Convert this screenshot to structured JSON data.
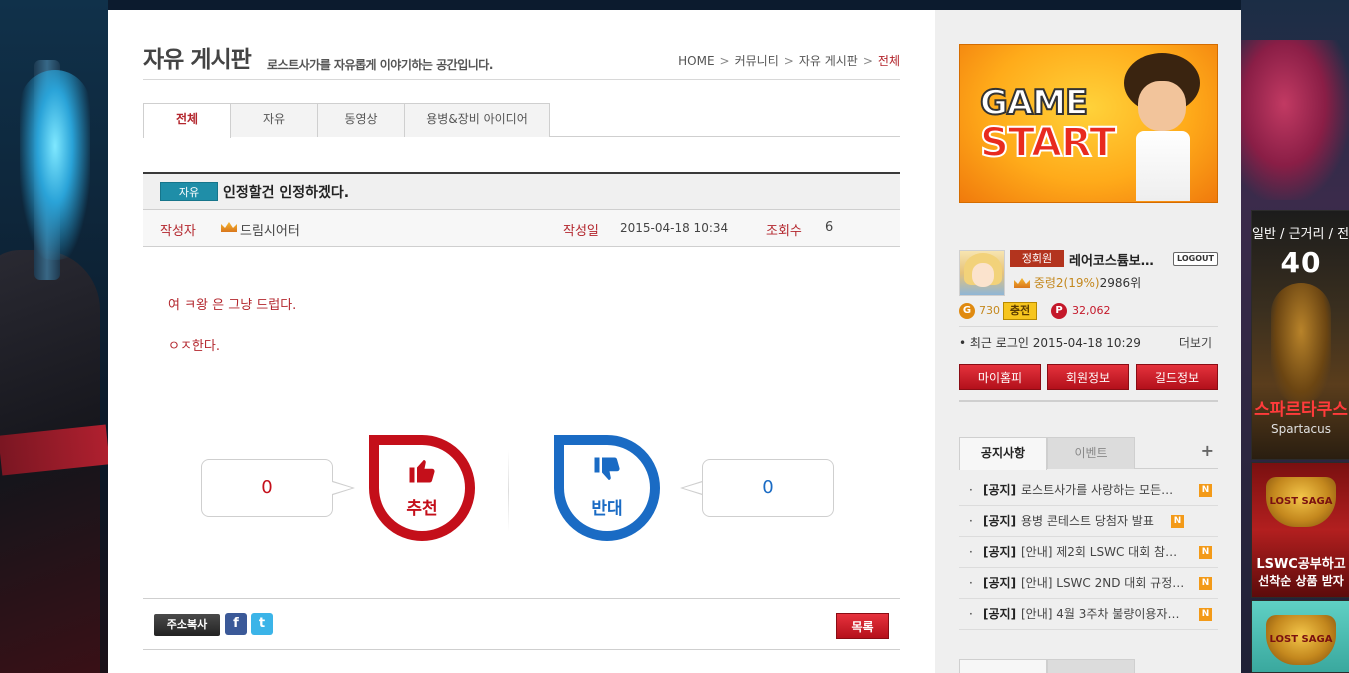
{
  "page": {
    "title": "자유 게시판",
    "subtitle": "로스트사가를 자유롭게 이야기하는 공간입니다."
  },
  "breadcrumb": [
    "HOME",
    "커뮤니티",
    "자유 게시판",
    "전체"
  ],
  "tabs": [
    {
      "label": "전체",
      "active": true
    },
    {
      "label": "자유",
      "active": false
    },
    {
      "label": "동영상",
      "active": false
    },
    {
      "label": "용병&장비 아이디어",
      "active": false
    }
  ],
  "post": {
    "category": "자유",
    "title": "인정할건 인정하겠다.",
    "author_label": "작성자",
    "author": "드림시어터",
    "date_label": "작성일",
    "date": "2015-04-18 10:34",
    "views_label": "조회수",
    "views": "6",
    "body": [
      "여 ㅋ왕 은 그냥 드럽다.",
      "ㅇㅈ한다."
    ]
  },
  "vote": {
    "up_count": "0",
    "up_label": "추천",
    "down_count": "0",
    "down_label": "반대",
    "up_icon": "thumbs-up-icon",
    "down_icon": "thumbs-down-icon"
  },
  "actions": {
    "copy_url": "주소복사",
    "facebook": "f",
    "twitter": "t",
    "list": "목록"
  },
  "sidebar": {
    "game_start": {
      "line1": "GAME",
      "line2": "START"
    },
    "profile": {
      "grade": "정회원",
      "name": "레어코스튬보…",
      "logout": "LOGOUT",
      "rank": "중령2(19%)",
      "rank_pos": "2986위",
      "gold_icon": "G",
      "gold": "730",
      "charge": "충전",
      "point_icon": "P",
      "points": "32,062",
      "last_login": "• 최근 로그인 2015-04-18 10:29",
      "more": "더보기"
    },
    "buttons": [
      "마이홈피",
      "회원정보",
      "길드정보"
    ],
    "notice_tabs": [
      "공지사항",
      "이벤트"
    ],
    "notices": [
      {
        "tag": "[공지]",
        "title": "로스트사가를 사랑하는 모든…"
      },
      {
        "tag": "[공지]",
        "title": "용병 콘테스트 당첨자 발표"
      },
      {
        "tag": "[공지]",
        "title": "[안내] 제2회 LSWC 대회 참…"
      },
      {
        "tag": "[공지]",
        "title": "[안내] LSWC 2ND 대회 규정…"
      },
      {
        "tag": "[공지]",
        "title": "[안내] 4월 3주차 불량이용자…"
      }
    ],
    "new_badge": "N"
  },
  "right_banners": {
    "banner1": {
      "top": "일반 / 근거리 / 전체",
      "num": "40",
      "title": "스파르타쿠스",
      "sub": "Spartacus"
    },
    "banner2": {
      "logo": "LOST SAGA",
      "line1": "LSWC공부하고",
      "line2": "선착순 상품 받자"
    },
    "banner3": {
      "logo": "LOST SAGA"
    }
  },
  "colors": {
    "accent_red": "#b3262d",
    "vote_red": "#c40f1a",
    "vote_blue": "#1a6bc4",
    "category_teal": "#1f8ea8"
  }
}
